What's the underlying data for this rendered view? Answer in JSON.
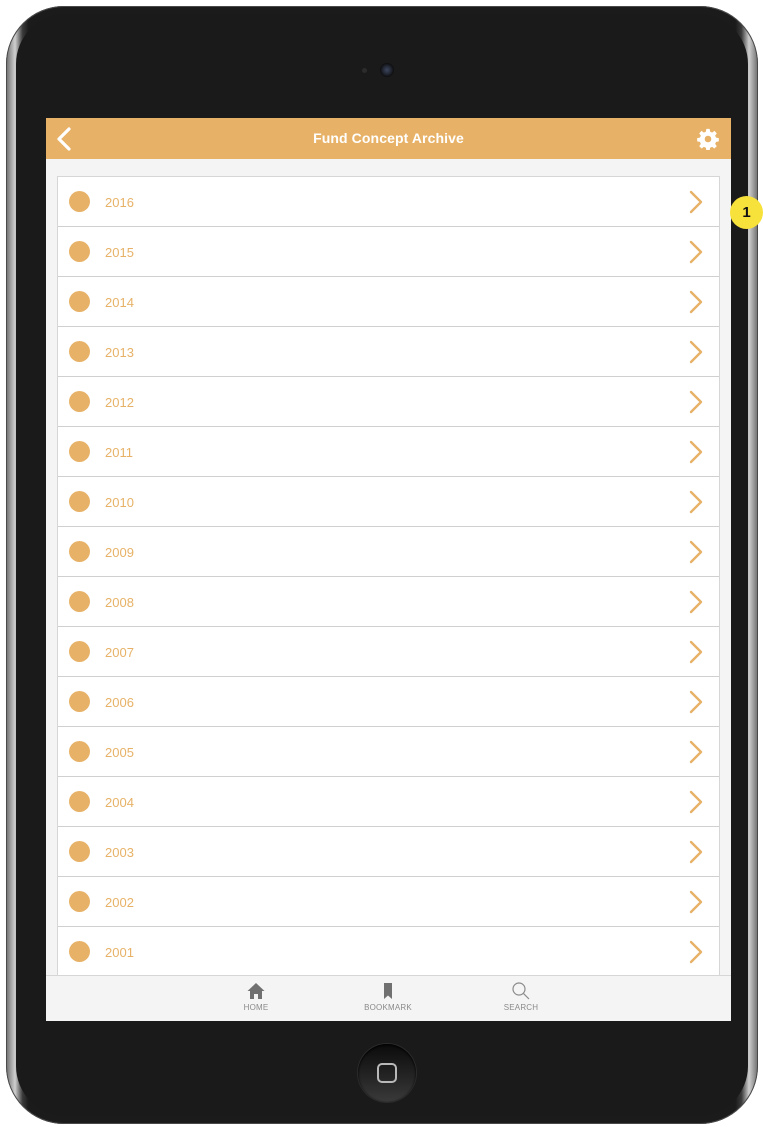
{
  "nav": {
    "title": "Fund Concept Archive",
    "back_icon": "chevron-left-icon",
    "settings_icon": "gear-icon"
  },
  "years": [
    "2016",
    "2015",
    "2014",
    "2013",
    "2012",
    "2011",
    "2010",
    "2009",
    "2008",
    "2007",
    "2006",
    "2005",
    "2004",
    "2003",
    "2002",
    "2001"
  ],
  "tabs": [
    {
      "label": "HOME",
      "icon": "home-icon"
    },
    {
      "label": "BOOKMARK",
      "icon": "bookmark-icon"
    },
    {
      "label": "SEARCH",
      "icon": "search-icon"
    }
  ],
  "annotation": {
    "number": "1"
  },
  "colors": {
    "accent": "#e7b267",
    "background": "#f4f4f4",
    "badge": "#f7e23b"
  }
}
